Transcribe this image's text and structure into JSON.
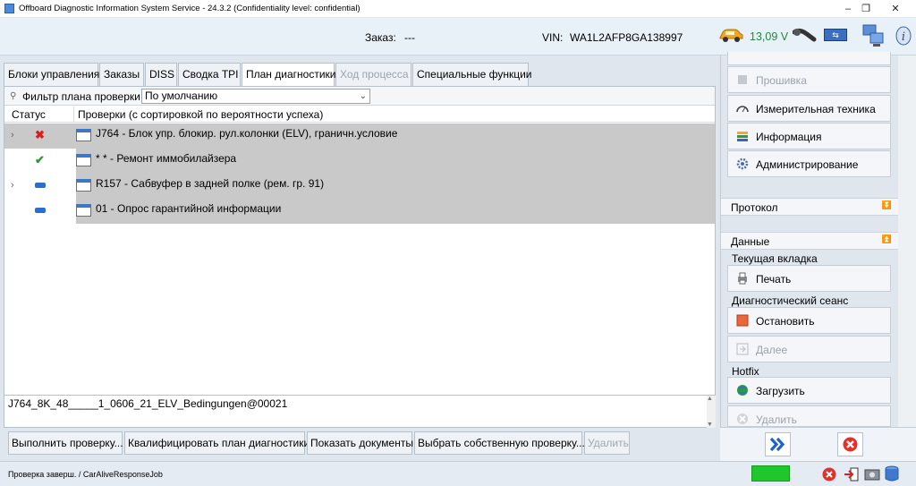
{
  "window": {
    "title": "Offboard Diagnostic Information System Service - 24.3.2 (Confidentiality level: confidential)",
    "controls": [
      "–",
      "❐",
      "✕"
    ]
  },
  "header": {
    "order_label": "Заказ:",
    "order_value": "---",
    "vin_label": "VIN:",
    "vin_value": "WA1L2AFP8GA138997",
    "voltage": "13,09 V",
    "voltage_color": "#1f8a3a"
  },
  "tabs": [
    {
      "label": "Блоки управления",
      "state": "normal"
    },
    {
      "label": "Заказы",
      "state": "normal"
    },
    {
      "label": "DISS",
      "state": "normal"
    },
    {
      "label": "Сводка TPI",
      "state": "normal"
    },
    {
      "label": "План диагностики",
      "state": "active"
    },
    {
      "label": "Ход процесса",
      "state": "disabled"
    },
    {
      "label": "Специальные функции",
      "state": "normal"
    }
  ],
  "filter": {
    "label": "Фильтр плана проверки",
    "value": "По умолчанию"
  },
  "table": {
    "headers": [
      "Статус",
      "Проверки (с сортировкой по вероятности успеха)"
    ],
    "rows": [
      {
        "status": "error",
        "status_color": "#d32020",
        "expandable": true,
        "label": "J764 - Блок упр. блокир. рул.колонки (ELV), граничн.условие"
      },
      {
        "status": "ok",
        "status_color": "#2e9c2e",
        "expandable": false,
        "label": "* * - Ремонт иммобилайзера"
      },
      {
        "status": "pending",
        "status_color": "#2a6fd0",
        "expandable": true,
        "label": "R157 - Сабвуфер в задней полке (рем. гр. 91)"
      },
      {
        "status": "pending",
        "status_color": "#2a6fd0",
        "expandable": false,
        "label": "01 - Опрос гарантийной информации"
      }
    ]
  },
  "detail_code": "J764_8K_48_____1_0606_21_ELV_Bedingungen@00021",
  "bottom_buttons": [
    {
      "label": "Выполнить проверку...",
      "state": "normal"
    },
    {
      "label": "Квалифицировать план диагностики",
      "state": "normal"
    },
    {
      "label": "Показать документы",
      "state": "normal"
    },
    {
      "label": "Выбрать собственную проверку...",
      "state": "normal"
    },
    {
      "label": "Удалить",
      "state": "disabled"
    }
  ],
  "sidebar": {
    "top_buttons": [
      {
        "label": "Прошивка",
        "state": "disabled",
        "icon": "chip-icon"
      },
      {
        "label": "Измерительная техника",
        "state": "normal",
        "icon": "gauge-icon"
      },
      {
        "label": "Информация",
        "state": "normal",
        "icon": "books-icon"
      },
      {
        "label": "Администрирование",
        "state": "normal",
        "icon": "gear-icon"
      }
    ],
    "protocol_section": "Протокол",
    "data_section": "Данные",
    "current_tab_label": "Текущая вкладка",
    "print_button": "Печать",
    "session_label": "Диагностический сеанс",
    "stop_button": "Остановить",
    "next_button": "Далее",
    "hotfix_label": "Hotfix",
    "load_button": "Загрузить",
    "delete_button": "Удалить"
  },
  "statusbar": {
    "text": "Проверка заверш. / CarAliveResponseJob",
    "indicator_color": "#1fc72d"
  }
}
